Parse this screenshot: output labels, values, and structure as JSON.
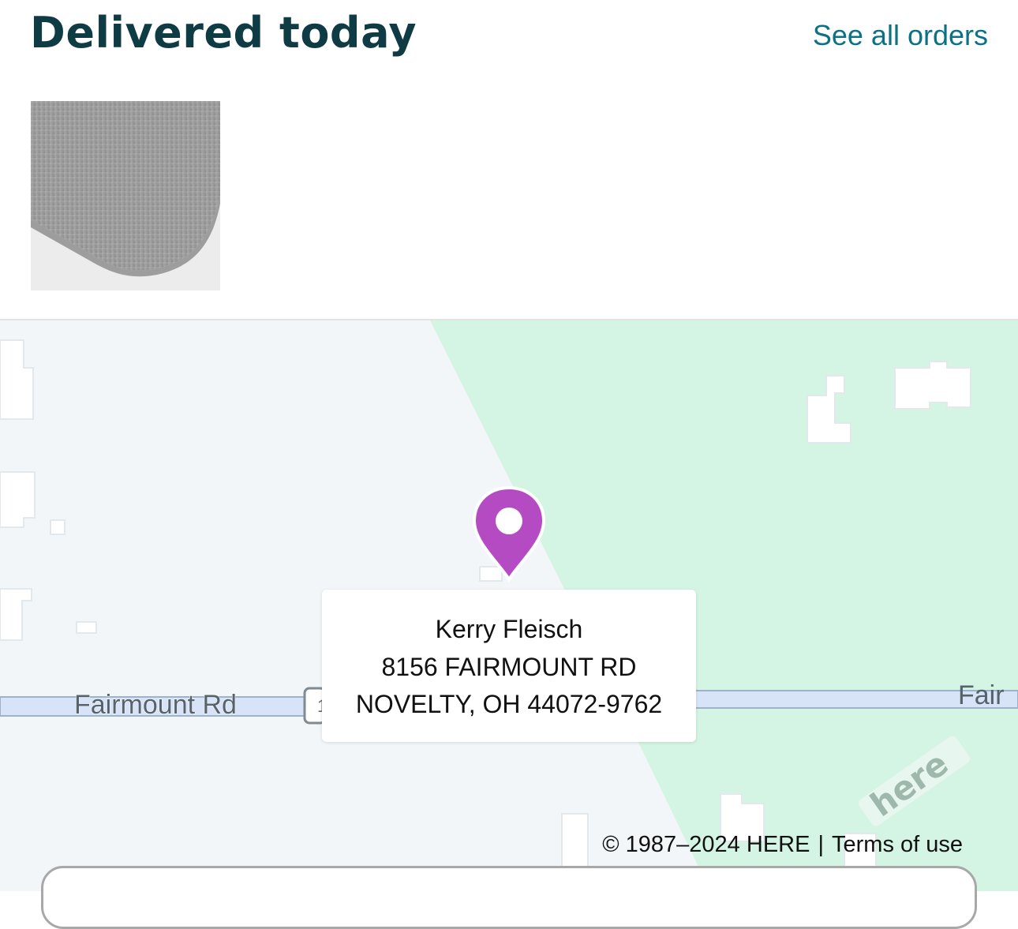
{
  "header": {
    "title": "Delivered today",
    "see_all_label": "See all orders"
  },
  "product": {
    "image_name": "fitted-sheet-thumbnail"
  },
  "map": {
    "road_labels": [
      "Fairmount Rd",
      "Fair"
    ],
    "route_shield_glyph": "1",
    "logo_text": "here",
    "pin_color": "#b44bc3",
    "wooded_color": "#d4f5e3",
    "land_color": "#f2f6f9",
    "road_color": "#d7e3f7"
  },
  "address_card": {
    "name": "Kerry Fleisch",
    "street": "8156 FAIRMOUNT RD",
    "city_line": "NOVELTY, OH 44072-9762"
  },
  "attribution": {
    "copyright": "© 1987–2024 HERE",
    "separator": "|",
    "terms_label": "Terms of use"
  }
}
